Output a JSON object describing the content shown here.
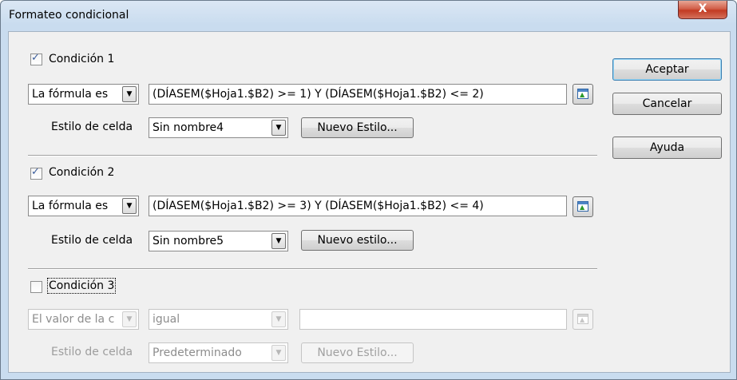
{
  "window": {
    "title": "Formateo condicional",
    "close_label": "X"
  },
  "conditions": [
    {
      "checkbox_label": "Condición 1",
      "checked": true,
      "type_value": "La fórmula es",
      "formula_value": "(DÍASEM($Hoja1.$B2) >= 1)  Y  (DÍASEM($Hoja1.$B2) <= 2)",
      "style_label": "Estilo de celda",
      "style_value": "Sin nombre4",
      "new_style_label": "Nuevo Estilo..."
    },
    {
      "checkbox_label": "Condición 2",
      "checked": true,
      "type_value": "La fórmula es",
      "formula_value": "(DÍASEM($Hoja1.$B2) >= 3)  Y  (DÍASEM($Hoja1.$B2) <= 4)",
      "style_label": "Estilo de celda",
      "style_value": "Sin nombre5",
      "new_style_label": "Nuevo estilo..."
    },
    {
      "checkbox_label": "Condición 3",
      "checked": false,
      "type_value": "El valor de la c",
      "operator_value": "igual",
      "formula_value": "",
      "style_label": "Estilo de celda",
      "style_value": "Predeterminado",
      "new_style_label": "Nuevo Estilo..."
    }
  ],
  "buttons": {
    "ok": "Aceptar",
    "cancel": "Cancelar",
    "help": "Ayuda"
  },
  "icons": {
    "shrink": "shrink-selection-icon",
    "dropdown": "chevron-down-icon",
    "check": "checkmark-icon"
  }
}
